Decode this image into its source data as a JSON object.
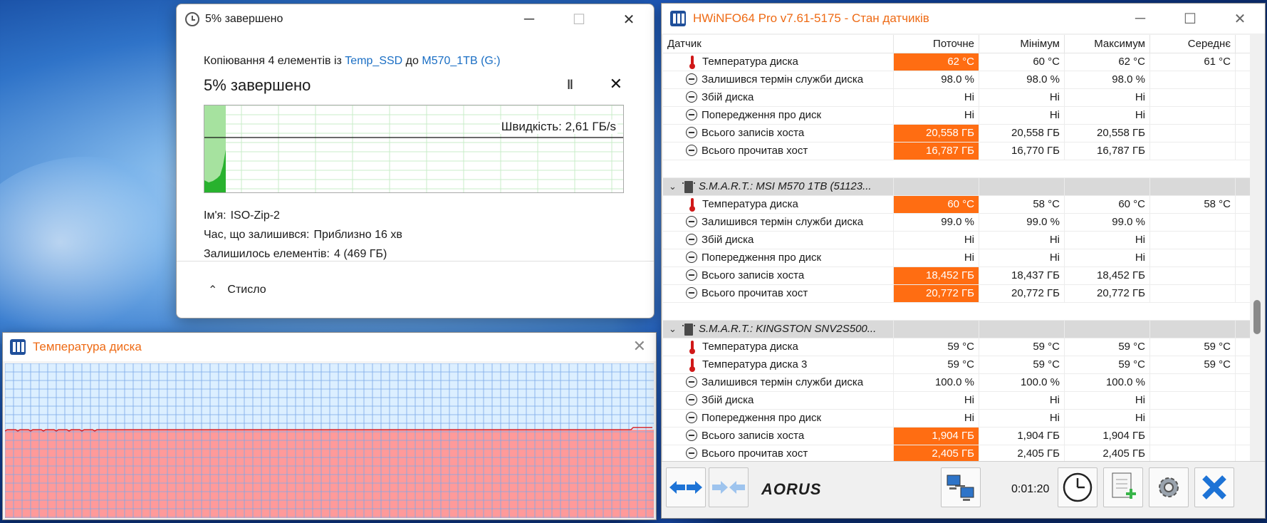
{
  "copy_dialog": {
    "title": "5% завершено",
    "line_prefix": "Копіювання 4 елементів із",
    "source": "Temp_SSD",
    "line_middle": "до",
    "destination": "M570_1TB (G:)",
    "status": "5% завершено",
    "progress_percent": 5,
    "pause_icon": "pause-icon",
    "cancel_icon": "close-icon",
    "speed_label": "Швидкість: 2,61 ГБ/s",
    "name_label": "Ім'я:",
    "name_value": "ISO-Zip-2",
    "time_label": "Час, що залишився:",
    "time_value": "Приблизно 16 хв",
    "items_label": "Залишилось елементів:",
    "items_value": "4 (469 ГБ)",
    "collapse_label": "Стисло",
    "colors": {
      "accent_green": "#28b22e",
      "link": "#1a6ec4"
    }
  },
  "temp_window": {
    "title": "Температура диска",
    "close_icon": "close-icon",
    "colors": {
      "fill": "#ff9a9a",
      "line": "#d8262a",
      "background": "#dcefff",
      "grid": "#7aa8e8"
    }
  },
  "hwinfo": {
    "title": "HWiNFO64 Pro v7.61-5175 - Стан датчиків",
    "columns": [
      "Датчик",
      "Поточне",
      "Мінімум",
      "Максимум",
      "Середнє"
    ],
    "rows": [
      {
        "type": "sensor",
        "icon": "thermometer-icon",
        "name": "Температура диска",
        "cur": "62 °C",
        "min": "60 °C",
        "max": "62 °C",
        "avg": "61 °C",
        "hot": true
      },
      {
        "type": "sensor",
        "icon": "gauge-icon",
        "name": "Залишився термін служби диска",
        "cur": "98.0 %",
        "min": "98.0 %",
        "max": "98.0 %",
        "avg": "",
        "hot": false
      },
      {
        "type": "sensor",
        "icon": "gauge-icon",
        "name": "Збій диска",
        "cur": "Ні",
        "min": "Ні",
        "max": "Ні",
        "avg": "",
        "hot": false
      },
      {
        "type": "sensor",
        "icon": "gauge-icon",
        "name": "Попередження про диск",
        "cur": "Ні",
        "min": "Ні",
        "max": "Ні",
        "avg": "",
        "hot": false
      },
      {
        "type": "sensor",
        "icon": "gauge-icon",
        "name": "Всього записів хоста",
        "cur": "20,558 ГБ",
        "min": "20,558 ГБ",
        "max": "20,558 ГБ",
        "avg": "",
        "hot": true
      },
      {
        "type": "sensor",
        "icon": "gauge-icon",
        "name": "Всього прочитав хост",
        "cur": "16,787 ГБ",
        "min": "16,770 ГБ",
        "max": "16,787 ГБ",
        "avg": "",
        "hot": true
      },
      {
        "type": "blank"
      },
      {
        "type": "group",
        "name": "S.M.A.R.T.: MSI M570 1TB (51123..."
      },
      {
        "type": "sensor",
        "icon": "thermometer-icon",
        "name": "Температура диска",
        "cur": "60 °C",
        "min": "58 °C",
        "max": "60 °C",
        "avg": "58 °C",
        "hot": true
      },
      {
        "type": "sensor",
        "icon": "gauge-icon",
        "name": "Залишився термін служби диска",
        "cur": "99.0 %",
        "min": "99.0 %",
        "max": "99.0 %",
        "avg": "",
        "hot": false
      },
      {
        "type": "sensor",
        "icon": "gauge-icon",
        "name": "Збій диска",
        "cur": "Ні",
        "min": "Ні",
        "max": "Ні",
        "avg": "",
        "hot": false
      },
      {
        "type": "sensor",
        "icon": "gauge-icon",
        "name": "Попередження про диск",
        "cur": "Ні",
        "min": "Ні",
        "max": "Ні",
        "avg": "",
        "hot": false
      },
      {
        "type": "sensor",
        "icon": "gauge-icon",
        "name": "Всього записів хоста",
        "cur": "18,452 ГБ",
        "min": "18,437 ГБ",
        "max": "18,452 ГБ",
        "avg": "",
        "hot": true
      },
      {
        "type": "sensor",
        "icon": "gauge-icon",
        "name": "Всього прочитав хост",
        "cur": "20,772 ГБ",
        "min": "20,772 ГБ",
        "max": "20,772 ГБ",
        "avg": "",
        "hot": true
      },
      {
        "type": "blank"
      },
      {
        "type": "group",
        "name": "S.M.A.R.T.: KINGSTON SNV2S500..."
      },
      {
        "type": "sensor",
        "icon": "thermometer-icon",
        "name": "Температура диска",
        "cur": "59 °C",
        "min": "59 °C",
        "max": "59 °C",
        "avg": "59 °C",
        "hot": false
      },
      {
        "type": "sensor",
        "icon": "thermometer-icon",
        "name": "Температура диска 3",
        "cur": "59 °C",
        "min": "59 °C",
        "max": "59 °C",
        "avg": "59 °C",
        "hot": false
      },
      {
        "type": "sensor",
        "icon": "gauge-icon",
        "name": "Залишився термін служби диска",
        "cur": "100.0 %",
        "min": "100.0 %",
        "max": "100.0 %",
        "avg": "",
        "hot": false
      },
      {
        "type": "sensor",
        "icon": "gauge-icon",
        "name": "Збій диска",
        "cur": "Ні",
        "min": "Ні",
        "max": "Ні",
        "avg": "",
        "hot": false
      },
      {
        "type": "sensor",
        "icon": "gauge-icon",
        "name": "Попередження про диск",
        "cur": "Ні",
        "min": "Ні",
        "max": "Ні",
        "avg": "",
        "hot": false
      },
      {
        "type": "sensor",
        "icon": "gauge-icon",
        "name": "Всього записів хоста",
        "cur": "1,904 ГБ",
        "min": "1,904 ГБ",
        "max": "1,904 ГБ",
        "avg": "",
        "hot": true
      },
      {
        "type": "sensor",
        "icon": "gauge-icon",
        "name": "Всього прочитав хост",
        "cur": "2,405 ГБ",
        "min": "2,405 ГБ",
        "max": "2,405 ГБ",
        "avg": "",
        "hot": true
      }
    ],
    "toolbar": {
      "nav_back_icon": "arrows-left-right-icon",
      "nav_disabled_icon": "arrows-inward-icon",
      "brand": "AORUS",
      "network_icon": "network-computers-icon",
      "elapsed": "0:01:20",
      "clock_icon": "clock-icon",
      "report_icon": "add-report-icon",
      "settings_icon": "gear-icon",
      "close_icon": "close-x-icon"
    },
    "colors": {
      "hot": "#ff6d12",
      "title": "#ee6a14"
    }
  }
}
